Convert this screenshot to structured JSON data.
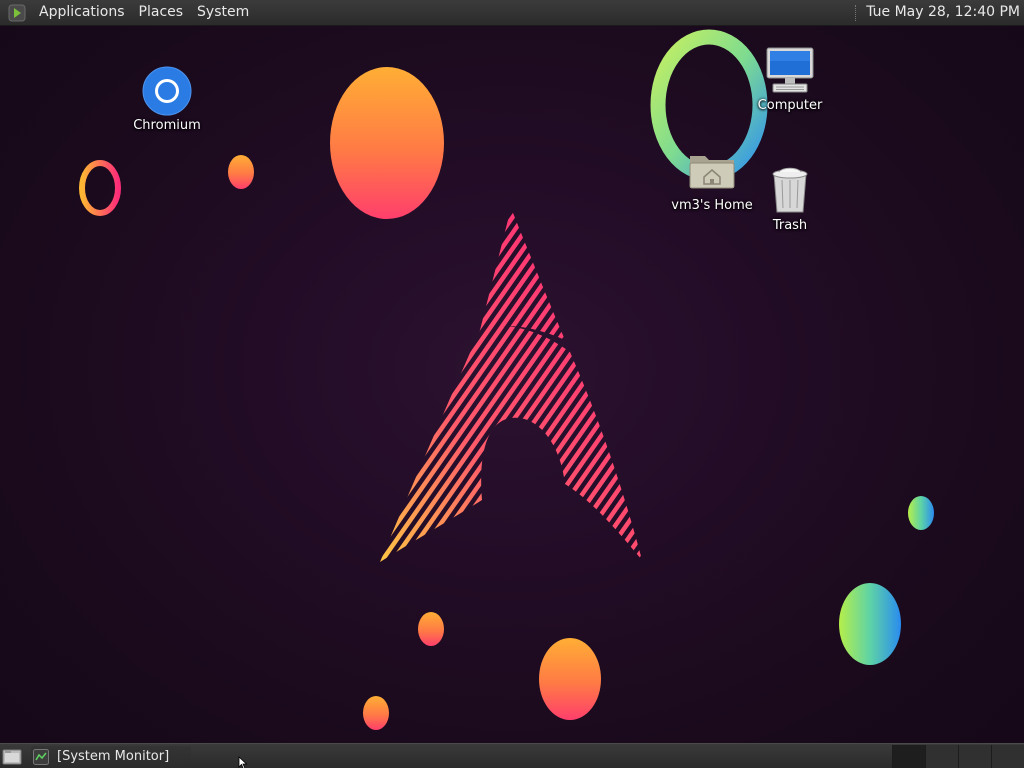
{
  "top_panel": {
    "menus": [
      "Applications",
      "Places",
      "System"
    ],
    "clock": "Tue May 28, 12:40 PM"
  },
  "desktop_icons": {
    "chromium": "Chromium",
    "computer": "Computer",
    "home": "vm3's Home",
    "trash": "Trash"
  },
  "bottom_panel": {
    "task_label": "[System Monitor]",
    "workspace_count": 4,
    "active_workspace": 1
  },
  "colors": {
    "panel": "#2e2e2e",
    "background": "#1a0a1c",
    "orange": "#ffa233",
    "pink": "#ff2d78"
  }
}
